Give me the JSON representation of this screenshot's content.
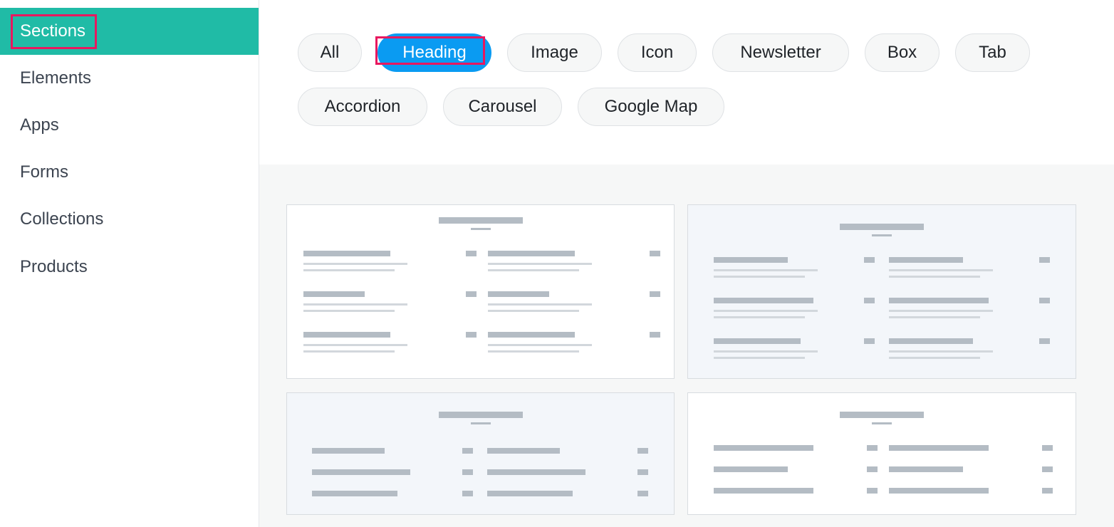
{
  "sidebar": {
    "items": [
      {
        "label": "Sections"
      },
      {
        "label": "Elements"
      },
      {
        "label": "Apps"
      },
      {
        "label": "Forms"
      },
      {
        "label": "Collections"
      },
      {
        "label": "Products"
      }
    ],
    "active": "Sections"
  },
  "filters": {
    "chips": [
      {
        "label": "All"
      },
      {
        "label": "Heading"
      },
      {
        "label": "Image"
      },
      {
        "label": "Icon"
      },
      {
        "label": "Newsletter"
      },
      {
        "label": "Box"
      },
      {
        "label": "Tab"
      },
      {
        "label": "Accordion"
      },
      {
        "label": "Carousel"
      },
      {
        "label": "Google Map"
      }
    ],
    "active": "Heading"
  },
  "templates": {
    "count": 4
  },
  "colors": {
    "sidebar_active": "#20bba6",
    "chip_active": "#0a9bf2",
    "highlight": "#e8185f",
    "placeholder_bar": "#b4bcc4"
  }
}
